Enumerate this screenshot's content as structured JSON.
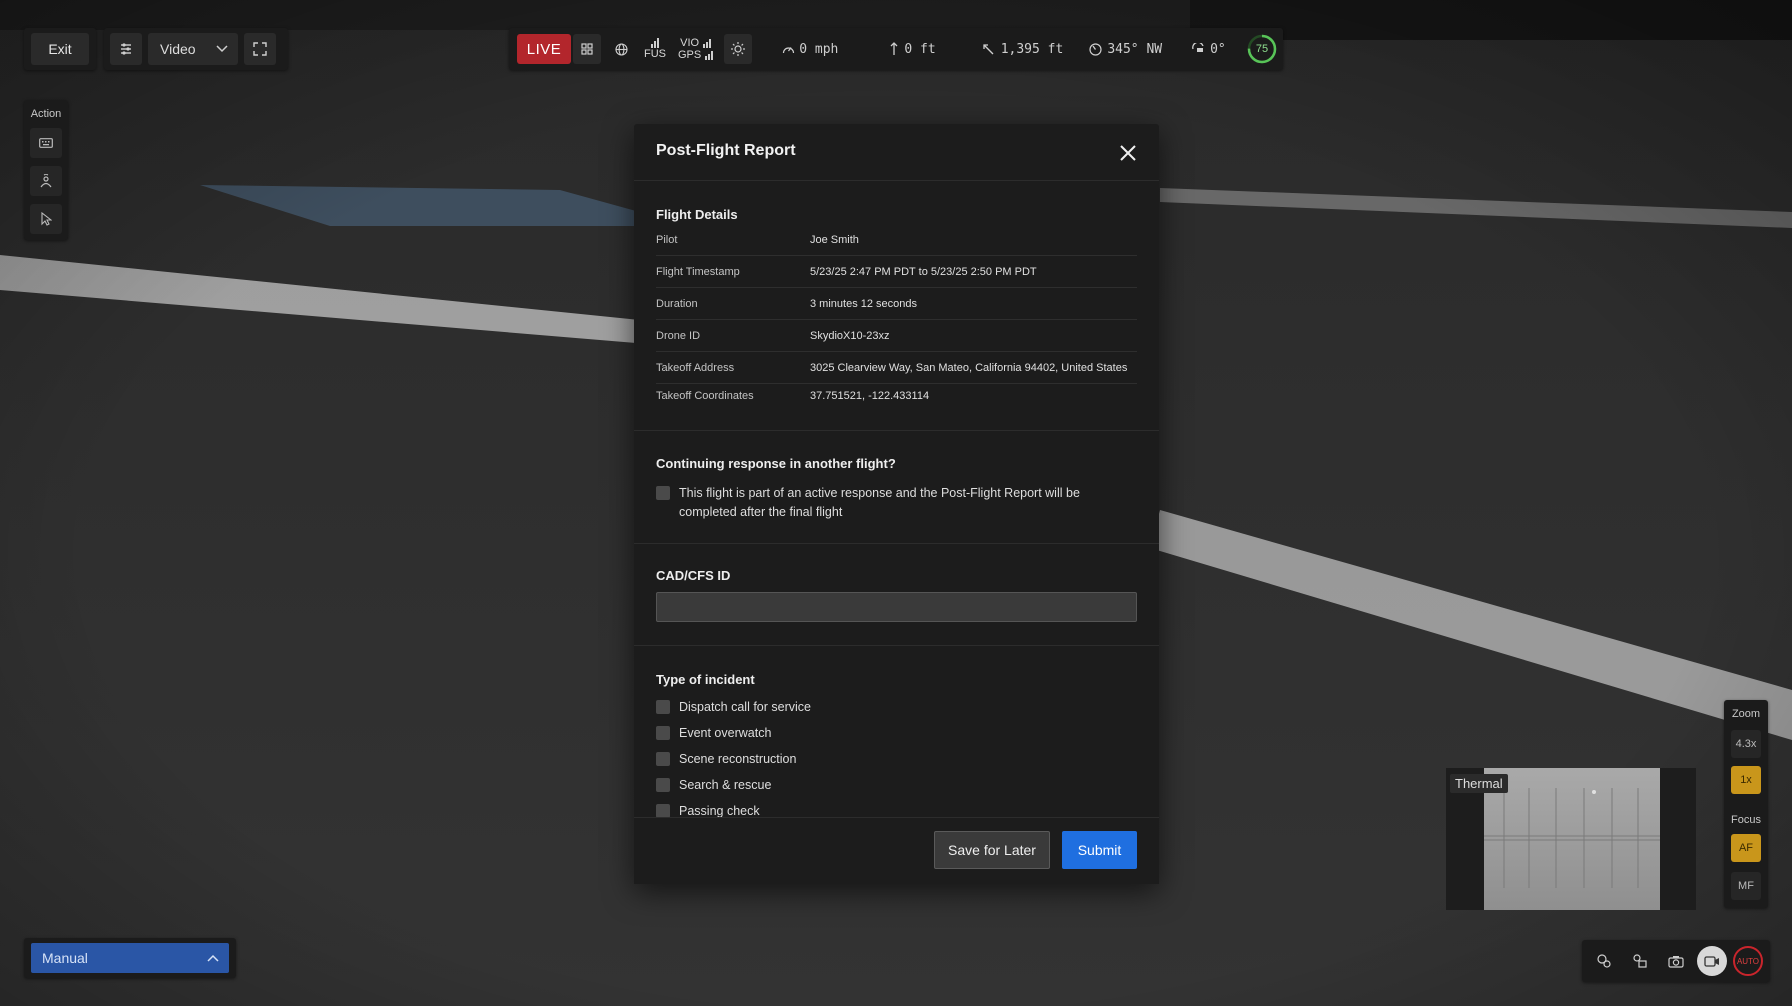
{
  "toolbar": {
    "exit_label": "Exit",
    "view_mode": "Video",
    "icons": {
      "settings": "sliders-icon",
      "view_dropdown": "chevron-down-icon",
      "expand": "expand-icon"
    }
  },
  "action_bar": {
    "label": "Action",
    "buttons": [
      "keyboard-icon",
      "person-pin-icon",
      "cursor-icon"
    ]
  },
  "telemetry": {
    "live_label": "LIVE",
    "fus_label": "FUS",
    "vio_label": "VIO",
    "gps_label": "GPS",
    "speed": "0 mph",
    "altitude": "0 ft",
    "distance": "1,395 ft",
    "heading": "345° NW",
    "gimbal": "0°",
    "battery": "75"
  },
  "zoom_panel": {
    "zoom_label": "Zoom",
    "zoom_options": [
      "4.3x",
      "1x"
    ],
    "zoom_selected": "1x",
    "focus_label": "Focus",
    "focus_options": [
      "AF",
      "MF"
    ],
    "focus_selected": "AF"
  },
  "thermal": {
    "label": "Thermal"
  },
  "flight_mode": {
    "value": "Manual"
  },
  "capture_bar": {
    "auto_label": "AUTO"
  },
  "colors": {
    "live_red": "#b3262c",
    "submit_blue": "#1f6fe0",
    "mode_blue": "#2a56a6",
    "zoom_active": "#c9961b",
    "battery_green": "#58c458"
  },
  "modal": {
    "title": "Post-Flight Report",
    "flight_details": {
      "heading": "Flight Details",
      "rows": [
        {
          "key": "Pilot",
          "value": "Joe Smith"
        },
        {
          "key": "Flight Timestamp",
          "value": "5/23/25 2:47 PM PDT to 5/23/25 2:50 PM PDT"
        },
        {
          "key": "Duration",
          "value": "3 minutes 12 seconds"
        },
        {
          "key": "Drone ID",
          "value": "SkydioX10-23xz"
        },
        {
          "key": "Takeoff Address",
          "value": "3025 Clearview Way, San Mateo, California 94402, United States"
        },
        {
          "key": "Takeoff Coordinates",
          "value": "37.751521, -122.433114"
        }
      ]
    },
    "continuing": {
      "heading": "Continuing response in another flight?",
      "checkbox_label": "This flight is part of an active response and the Post-Flight Report will be completed after the final flight",
      "checked": false
    },
    "cad": {
      "heading": "CAD/CFS ID",
      "value": "",
      "placeholder": ""
    },
    "incident": {
      "heading": "Type of incident",
      "options": [
        "Dispatch call for service",
        "Event overwatch",
        "Scene reconstruction",
        "Search & rescue",
        "Passing check"
      ]
    },
    "footer": {
      "save_label": "Save for Later",
      "submit_label": "Submit"
    }
  }
}
